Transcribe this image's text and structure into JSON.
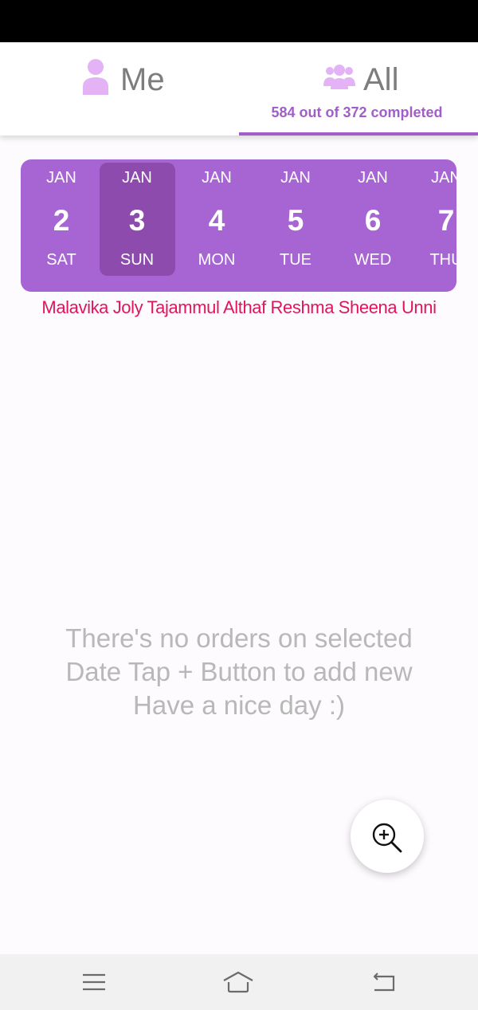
{
  "tabs": {
    "me": {
      "label": "Me",
      "icon": "person-icon"
    },
    "all": {
      "label": "All",
      "icon": "group-icon",
      "subtitle": "584 out of 372 completed"
    },
    "active": "all",
    "accent_color": "#a25dcb"
  },
  "calendar": {
    "background_color": "#a765d4",
    "selected_color": "#8c4bad",
    "selected_index": 1,
    "days": [
      {
        "month": "JAN",
        "day": "2",
        "weekday": "SAT"
      },
      {
        "month": "JAN",
        "day": "3",
        "weekday": "SUN"
      },
      {
        "month": "JAN",
        "day": "4",
        "weekday": "MON"
      },
      {
        "month": "JAN",
        "day": "5",
        "weekday": "TUE"
      },
      {
        "month": "JAN",
        "day": "6",
        "weekday": "WED"
      },
      {
        "month": "JAN",
        "day": "7",
        "weekday": "THU"
      }
    ]
  },
  "names_line": "Malavika Joly Tajammul Althaf Reshma Sheena Unni",
  "names_color": "#e0165a",
  "empty_state": {
    "line1": "There's no orders on selected",
    "line2": "Date Tap + Button to add new",
    "line3": "Have a nice day :)"
  },
  "fab": {
    "icon": "zoom-in-icon"
  },
  "system_nav": {
    "menu_icon": "menu-icon",
    "home_icon": "home-icon",
    "back_icon": "back-icon"
  }
}
